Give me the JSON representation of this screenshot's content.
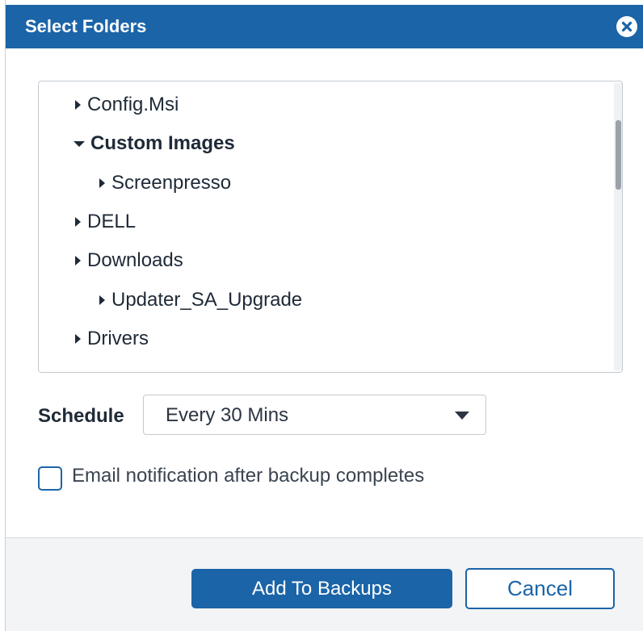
{
  "dialog": {
    "title": "Select Folders",
    "close_icon": "close-circle-icon"
  },
  "tree": {
    "items": [
      {
        "label": "Config.Msi",
        "expanded": false,
        "bold": false,
        "level": 1
      },
      {
        "label": "Custom Images",
        "expanded": true,
        "bold": true,
        "level": 1
      },
      {
        "label": "Screenpresso",
        "expanded": false,
        "bold": false,
        "level": 2
      },
      {
        "label": "DELL",
        "expanded": false,
        "bold": false,
        "level": 1
      },
      {
        "label": "Downloads",
        "expanded": false,
        "bold": false,
        "level": 1
      },
      {
        "label": "Updater_SA_Upgrade",
        "expanded": false,
        "bold": false,
        "level": 2
      },
      {
        "label": "Drivers",
        "expanded": false,
        "bold": false,
        "level": 1
      }
    ]
  },
  "schedule": {
    "label": "Schedule",
    "value": "Every 30 Mins"
  },
  "email_notification": {
    "label": "Email notification after backup completes",
    "checked": false
  },
  "footer": {
    "add_label": "Add To Backups",
    "cancel_label": "Cancel"
  },
  "colors": {
    "accent": "#1b64a8",
    "text": "#1f2a37",
    "border": "#c4cad1",
    "footer_bg": "#f3f4f5"
  }
}
